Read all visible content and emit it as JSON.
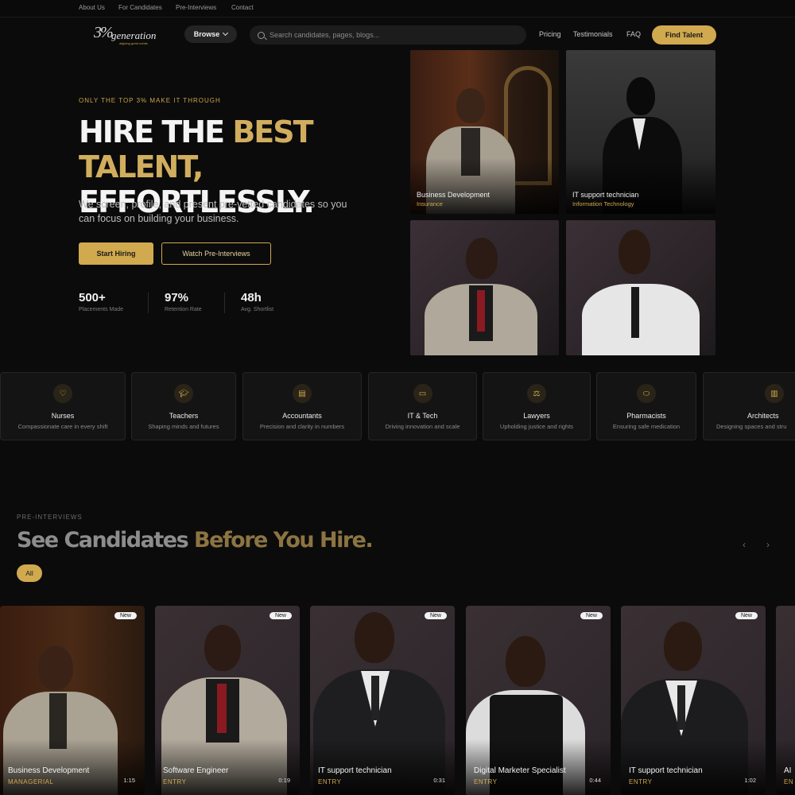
{
  "util_nav": [
    "About Us",
    "For Candidates",
    "Pre-Interviews",
    "Contact"
  ],
  "logo": {
    "number": "3%",
    "word": "generation",
    "tagline": "aligning great minds"
  },
  "header": {
    "browse_label": "Browse",
    "search_placeholder": "Search candidates, pages, blogs...",
    "links": [
      "Pricing",
      "Testimonials",
      "FAQ"
    ],
    "cta": "Find Talent"
  },
  "hero": {
    "eyebrow": "ONLY THE TOP 3% MAKE IT THROUGH",
    "title_part1": "HIRE THE ",
    "title_gold": "BEST TALENT,",
    "title_part2": "EFFORTLESSLY.",
    "subtitle": "We screen, profile, and present pre-vetted candidates so you can focus on building your business.",
    "primary_button": "Start Hiring",
    "secondary_button": "Watch Pre-Interviews",
    "stats": [
      {
        "value": "500+",
        "label": "Placements Made"
      },
      {
        "value": "97%",
        "label": "Retention Rate"
      },
      {
        "value": "48h",
        "label": "Avg. Shortlist"
      }
    ],
    "photos": [
      {
        "title": "Business Development",
        "subtitle": "Insurance"
      },
      {
        "title": "IT support technician",
        "subtitle": "Information Technology"
      }
    ]
  },
  "professions": [
    {
      "name": "Nurses",
      "desc": "Compassionate care in every shift",
      "icon": "heart-icon"
    },
    {
      "name": "Teachers",
      "desc": "Shaping minds and futures",
      "icon": "graduation-cap-icon"
    },
    {
      "name": "Accountants",
      "desc": "Precision and clarity in numbers",
      "icon": "calculator-icon"
    },
    {
      "name": "IT & Tech",
      "desc": "Driving innovation and scale",
      "icon": "monitor-icon"
    },
    {
      "name": "Lawyers",
      "desc": "Upholding justice and rights",
      "icon": "scales-icon"
    },
    {
      "name": "Pharmacists",
      "desc": "Ensuring safe medication",
      "icon": "pill-icon"
    },
    {
      "name": "Architects",
      "desc": "Designing spaces and stru",
      "icon": "building-icon"
    }
  ],
  "preinterviews": {
    "eyebrow": "PRE-INTERVIEWS",
    "title_part1": "See Candidates ",
    "title_gold": "Before You Hire.",
    "filter_all": "All",
    "prev": "‹",
    "next": "›",
    "cards": [
      {
        "badge": "New",
        "title": "Business Development",
        "level": "MANAGERIAL",
        "duration": "1:15"
      },
      {
        "badge": "New",
        "title": "Software Engineer",
        "level": "ENTRY",
        "duration": "0:19"
      },
      {
        "badge": "New",
        "title": "IT support technician",
        "level": "ENTRY",
        "duration": "0:31"
      },
      {
        "badge": "New",
        "title": "Digital Marketer Specialist",
        "level": "ENTRY",
        "duration": "0:44"
      },
      {
        "badge": "New",
        "title": "IT support technician",
        "level": "ENTRY",
        "duration": "1:02"
      },
      {
        "badge": "",
        "title": "AI",
        "level": "EN",
        "duration": ""
      }
    ]
  },
  "colors": {
    "accent": "#d1a94e",
    "background": "#0b0b0b",
    "card": "#141414"
  }
}
